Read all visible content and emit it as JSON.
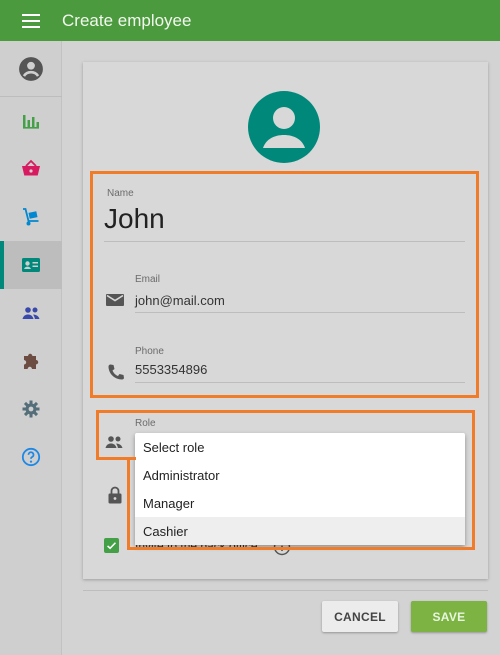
{
  "header": {
    "title": "Create employee",
    "menu_icon": "hamburger-menu-icon",
    "bar_color": "#4b9a3d"
  },
  "sidebar": {
    "items": [
      {
        "icon": "account-circle-icon",
        "color": "#555555",
        "active": false
      },
      {
        "icon": "bar-chart-icon",
        "color": "#43a047",
        "active": false
      },
      {
        "icon": "shopping-basket-icon",
        "color": "#d81b60",
        "active": false
      },
      {
        "icon": "dolly-icon",
        "color": "#0288d1",
        "active": false
      },
      {
        "icon": "employee-card-icon",
        "color": "#00897b",
        "active": true
      },
      {
        "icon": "people-icon",
        "color": "#3949ab",
        "active": false
      },
      {
        "icon": "puzzle-icon",
        "color": "#6d4c41",
        "active": false
      },
      {
        "icon": "settings-gear-icon",
        "color": "#546e7a",
        "active": false
      },
      {
        "icon": "help-circle-icon",
        "color": "#1e88e5",
        "active": false
      }
    ]
  },
  "form": {
    "avatar_icon": "person-avatar-icon",
    "avatar_color": "#00897b",
    "name": {
      "label": "Name",
      "value": "John"
    },
    "email": {
      "label": "Email",
      "value": "john@mail.com",
      "icon": "email-icon"
    },
    "phone": {
      "label": "Phone",
      "value": "5553354896",
      "icon": "phone-icon"
    },
    "role": {
      "label": "Role",
      "icon": "people-icon",
      "options": [
        "Select role",
        "Administrator",
        "Manager",
        "Cashier"
      ],
      "highlighted_option": "Cashier"
    },
    "pin_icon": "lock-icon",
    "invite": {
      "label": "Invite to the back office",
      "checked": true,
      "info_icon": "info-icon"
    }
  },
  "actions": {
    "cancel_label": "CANCEL",
    "save_label": "SAVE"
  },
  "highlight_color": "#f07b29"
}
